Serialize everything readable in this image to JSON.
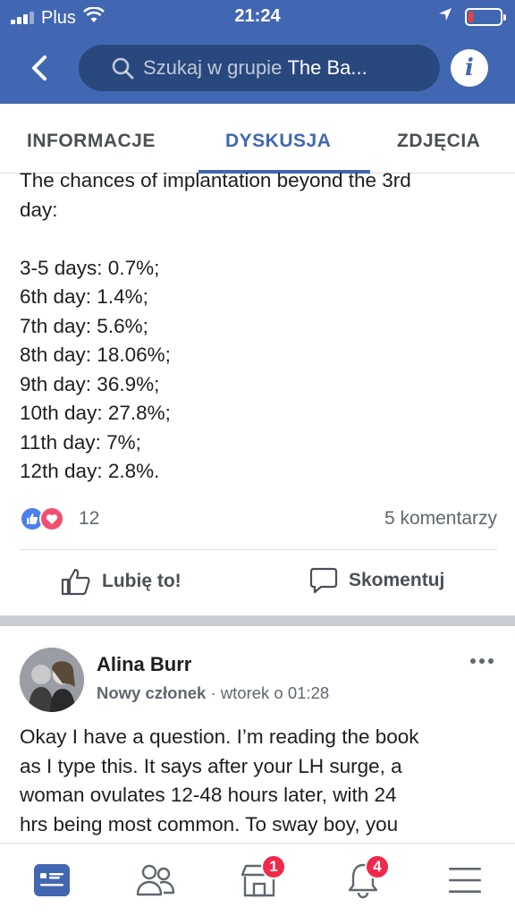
{
  "status_bar": {
    "carrier": "Plus",
    "time": "21:24"
  },
  "header": {
    "search_placeholder": "Szukaj w grupie",
    "search_group": "The Ba..."
  },
  "tabs": [
    {
      "label": "INFORMACJE"
    },
    {
      "label": "DYSKUSJA"
    },
    {
      "label": "ZDJĘCIA"
    }
  ],
  "post1": {
    "lines_top": [
      "The chances of implantation beyond the 3rd",
      "day:"
    ],
    "lines": [
      "3-5 days: 0.7%;",
      "6th day: 1.4%;",
      "7th day: 5.6%;",
      "8th day: 18.06%;",
      "9th day: 36.9%;",
      "10th day: 27.8%;",
      "11th day: 7%;",
      "12th day: 2.8%."
    ],
    "reaction_count": "12",
    "comment_count": "5 komentarzy",
    "like_label": "Lubię to!",
    "comment_label": "Skomentuj"
  },
  "post2": {
    "author": "Alina Burr",
    "role": "Nowy członek",
    "separator": "·",
    "timestamp": "wtorek o 01:28",
    "lines": [
      "Okay I have a question. I’m reading the book",
      "as I type this. It says after your LH surge, a",
      "woman ovulates 12-48 hours later, with 24",
      "hrs being most common. To sway boy, you"
    ]
  },
  "bottom_nav": {
    "marketplace_badge": "1",
    "notifications_badge": "4"
  },
  "colors": {
    "brand": "#4267b2",
    "badge": "#f02849"
  }
}
